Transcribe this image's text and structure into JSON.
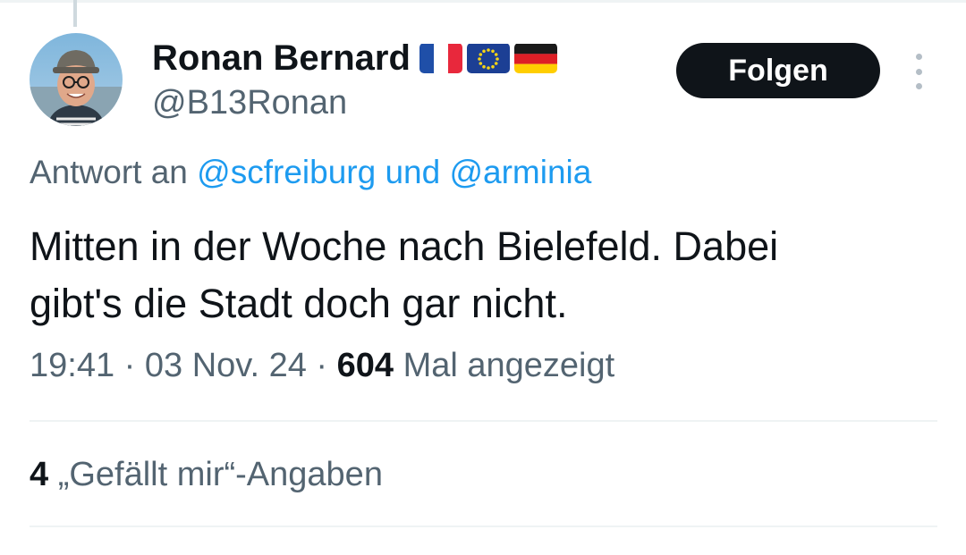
{
  "tweet": {
    "author": {
      "name": "Ronan Bernard",
      "handle": "@B13Ronan",
      "flags": [
        "french-flag",
        "eu-flag",
        "german-flag"
      ]
    },
    "follow_label": "Folgen",
    "reply_to": {
      "prefix": "Antwort an",
      "mention_1": "@scfreiburg",
      "conjunction": "und",
      "mention_2": "@arminia"
    },
    "text_line_1": "Mitten in der Woche nach Bielefeld. Dabei",
    "text_line_2": "gibt's die Stadt doch gar nicht.",
    "time": "19:41",
    "date": "03 Nov. 24",
    "separator": "·",
    "views_count": "604",
    "views_label": "Mal angezeigt",
    "likes_count": "4",
    "likes_label": "„Gefällt mir“-Angaben"
  },
  "colors": {
    "text_primary": "#0f1419",
    "text_secondary": "#536471",
    "link": "#1d9bf0",
    "divider": "#eff3f4",
    "button_bg": "#0f1419"
  }
}
